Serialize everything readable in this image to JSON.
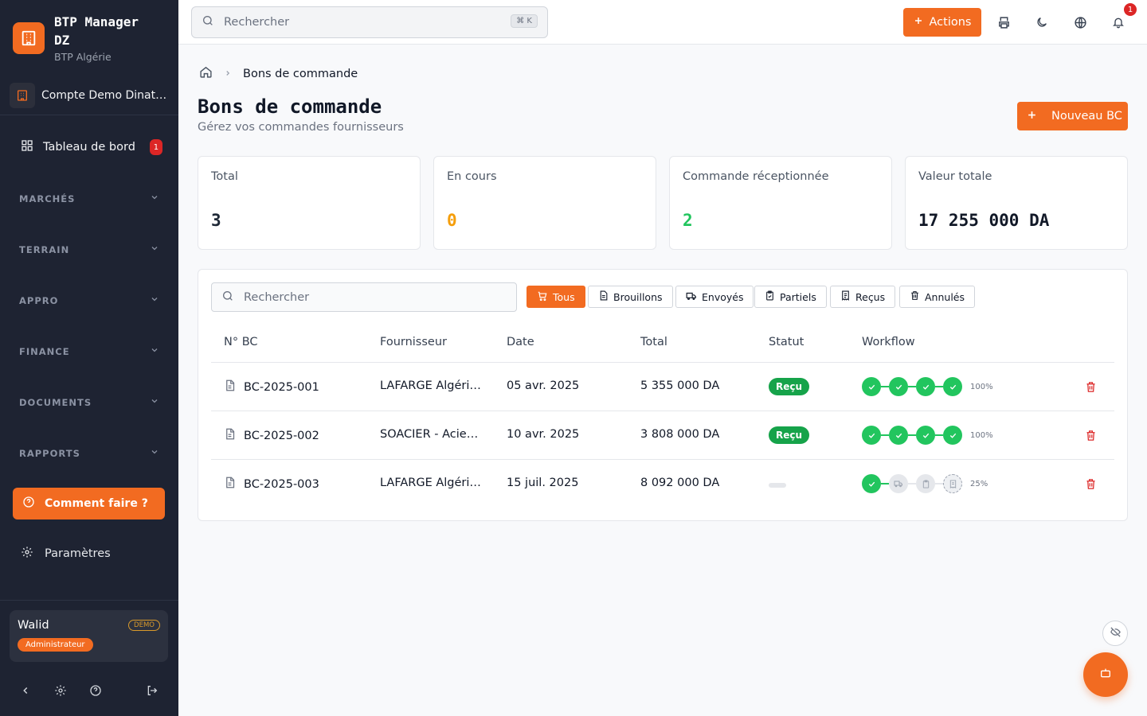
{
  "brand": {
    "name": "BTP Manager DZ",
    "sub": "BTP Algérie"
  },
  "account": {
    "name": "Compte Demo Dinate…"
  },
  "nav": {
    "dashboard": {
      "label": "Tableau de bord",
      "badge": "1"
    },
    "sections": [
      "MARCHÉS",
      "TERRAIN",
      "APPRO",
      "FINANCE",
      "DOCUMENTS",
      "RAPPORTS"
    ],
    "help": "Comment faire ?",
    "settings": "Paramètres"
  },
  "user": {
    "name": "Walid",
    "tag": "DEMO",
    "role": "Administrateur"
  },
  "topbar": {
    "search_placeholder": "Rechercher",
    "shortcut": "⌘ K",
    "actions_label": "Actions",
    "notif_count": "1"
  },
  "breadcrumb": {
    "current": "Bons de commande"
  },
  "page": {
    "title": "Bons de commande",
    "subtitle": "Gérez vos commandes fournisseurs",
    "new_button": "Nouveau BC"
  },
  "stats": [
    {
      "label": "Total",
      "value": "3",
      "color": "#1f2937"
    },
    {
      "label": "En cours",
      "value": "0",
      "color": "#f59e0b"
    },
    {
      "label": "Commande réceptionnée",
      "value": "2",
      "color": "#22c55e"
    },
    {
      "label": "Valeur totale",
      "value": "17 255 000 DA",
      "color": "#111827"
    }
  ],
  "table": {
    "search_placeholder": "Rechercher",
    "filters": [
      "Tous",
      "Brouillons",
      "Envoyés",
      "Partiels",
      "Reçus",
      "Annulés"
    ],
    "active_filter": "Tous",
    "columns": [
      "N° BC",
      "Fournisseur",
      "Date",
      "Total",
      "Statut",
      "Workflow"
    ],
    "rows": [
      {
        "num": "BC-2025-001",
        "supplier": "LAFARGE Algéri…",
        "date": "05 avr. 2025",
        "total": "5 355 000 DA",
        "status": "Reçu",
        "workflow_pct": "100%",
        "steps": [
          "done",
          "done",
          "done",
          "done"
        ]
      },
      {
        "num": "BC-2025-002",
        "supplier": "SOACIER - Acie…",
        "date": "10 avr. 2025",
        "total": "3 808 000 DA",
        "status": "Reçu",
        "workflow_pct": "100%",
        "steps": [
          "done",
          "done",
          "done",
          "done"
        ]
      },
      {
        "num": "BC-2025-003",
        "supplier": "LAFARGE Algéri…",
        "date": "15 juil. 2025",
        "total": "8 092 000 DA",
        "status": "",
        "workflow_pct": "25%",
        "steps": [
          "done",
          "pending",
          "pending",
          "current"
        ]
      }
    ]
  },
  "colors": {
    "accent": "#f26b21",
    "sidebar": "#1e2332",
    "success": "#22c55e",
    "danger": "#dc2626"
  }
}
